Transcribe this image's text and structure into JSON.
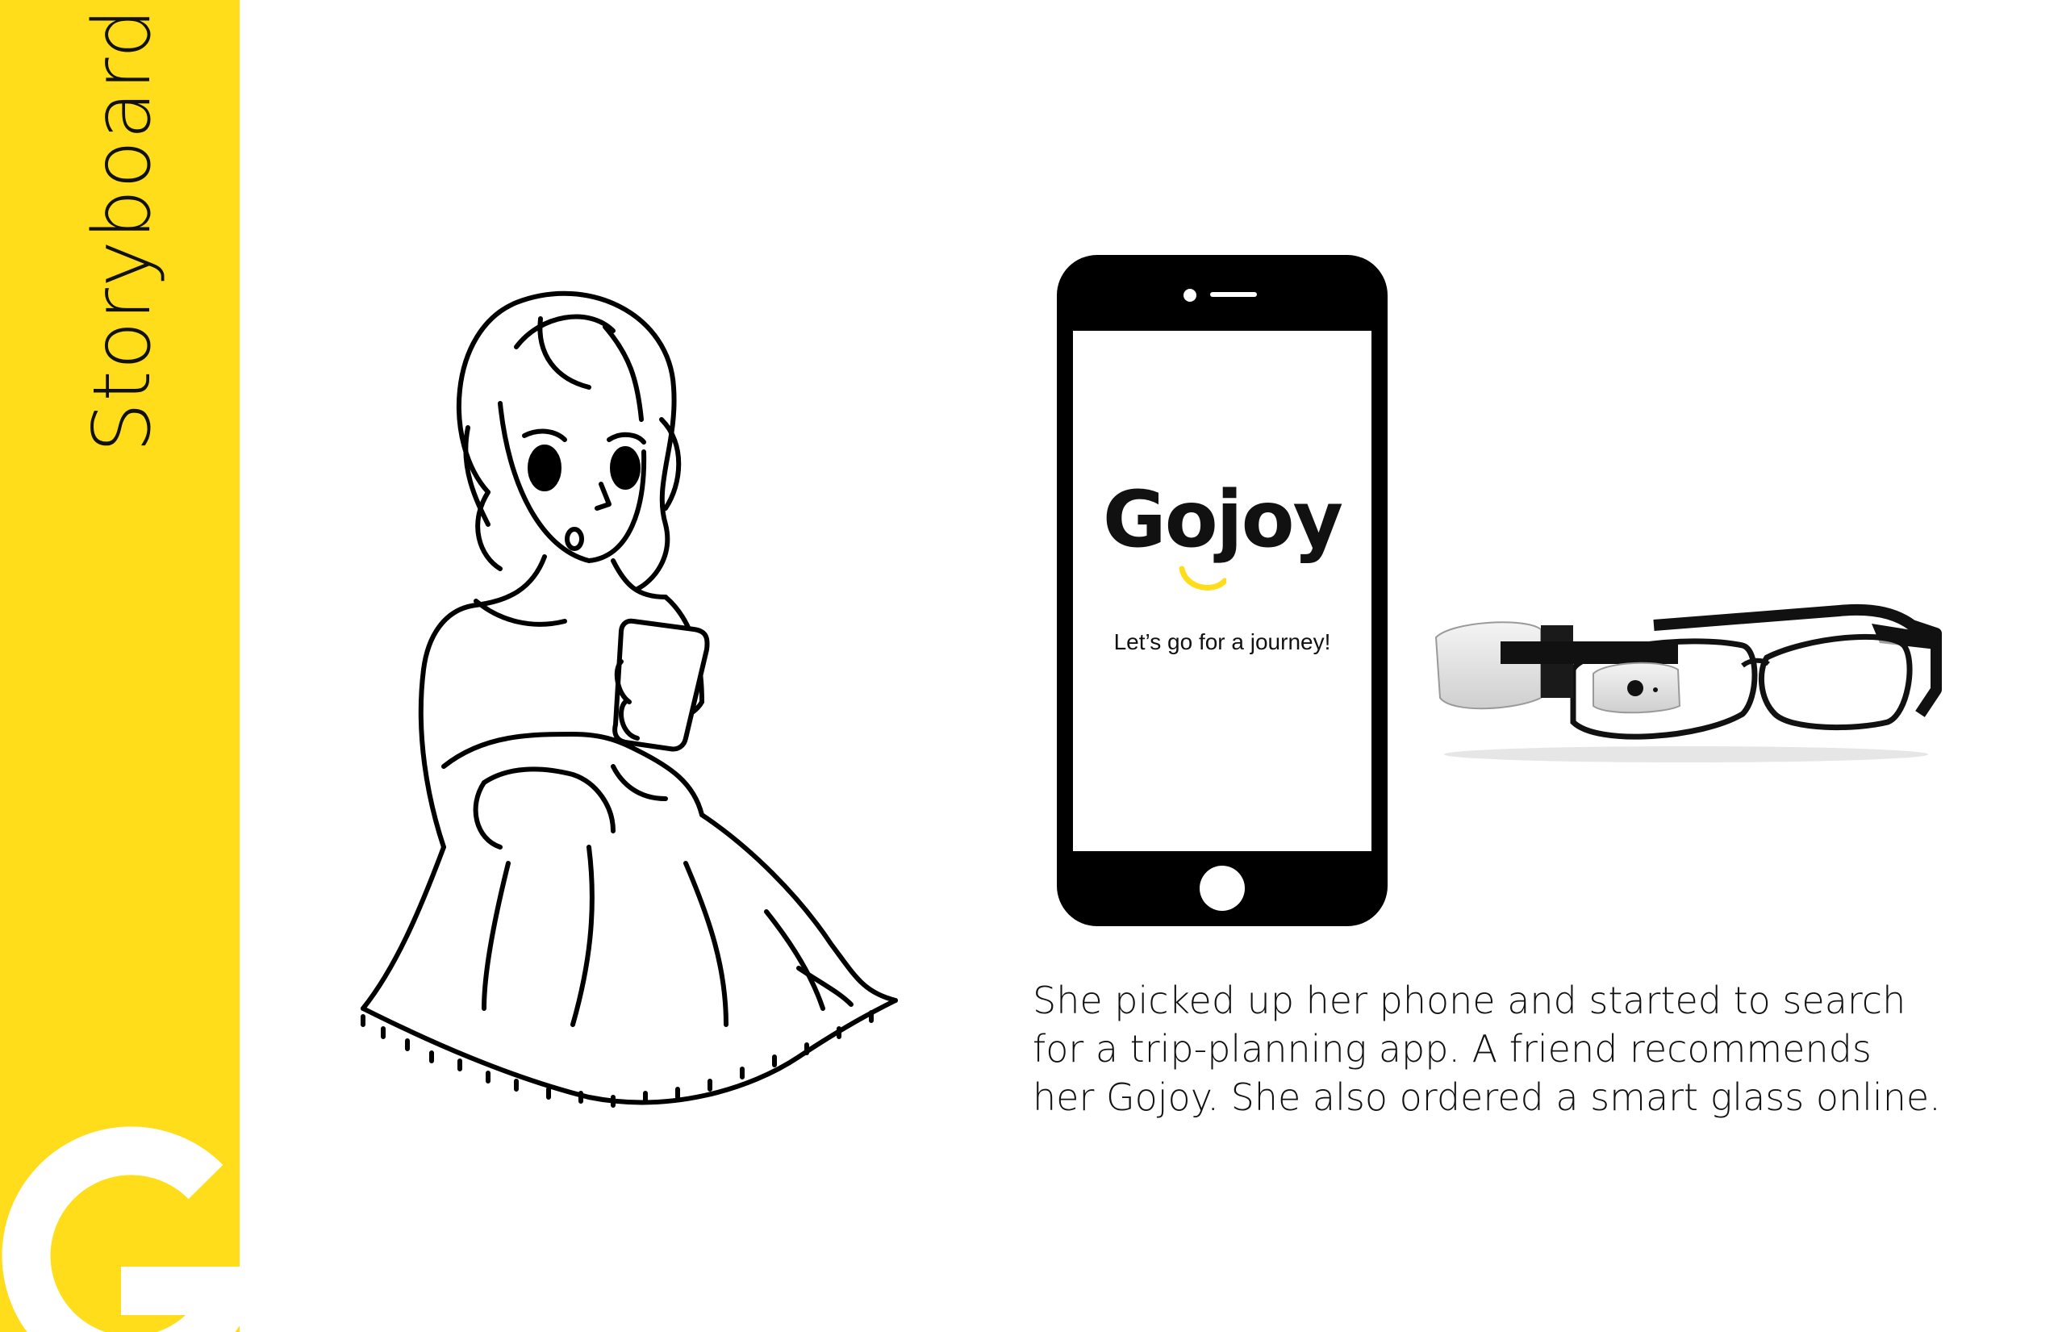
{
  "sidebar": {
    "title": "Storyboard",
    "accent_color": "#FFDD1B",
    "logo_icon": "gojoy-g-logo"
  },
  "phone": {
    "app_name": "Gojoy",
    "tagline": "Let’s go for a journey!",
    "accent_color": "#FFDD1B"
  },
  "caption": {
    "lines": [
      "She picked up her phone and started to search",
      "for a trip-planning app. A friend recommends",
      "her Gojoy. She also ordered a smart glass online."
    ]
  }
}
